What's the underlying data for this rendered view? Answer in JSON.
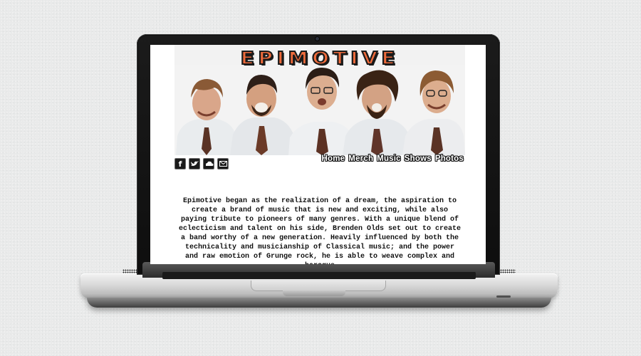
{
  "site": {
    "logo_text": "EPIMOTIVE",
    "nav": [
      {
        "label": "Home"
      },
      {
        "label": "Merch"
      },
      {
        "label": "Music"
      },
      {
        "label": "Shows"
      },
      {
        "label": "Photos"
      }
    ],
    "social": [
      {
        "icon": "facebook-icon",
        "glyph": "f"
      },
      {
        "icon": "twitter-icon",
        "glyph": "bird"
      },
      {
        "icon": "soundcloud-icon",
        "glyph": "cloud"
      },
      {
        "icon": "email-icon",
        "glyph": "envelope"
      }
    ],
    "bio": "Epimotive began as the realization of a dream, the aspiration to create a brand of music that is new and exciting, while also paying tribute to pioneers of many genres. With a unique blend of eclecticism and talent on his side, Brenden Olds set out to create a band worthy of a new generation. Heavily influenced by both the technicality and musicianship of Classical music; and the power and raw emotion of Grunge rock, he is able to weave complex and baroque",
    "colors": {
      "logo_orange": "#ef6b3b",
      "logo_outline": "#1a1a1a",
      "page_background": "#ffffff",
      "nav_text": "#ffffff"
    }
  }
}
